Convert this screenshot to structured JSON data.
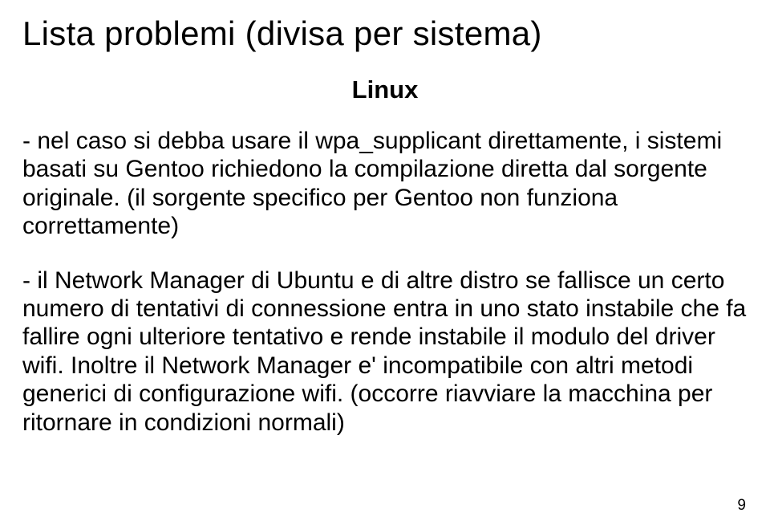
{
  "title": "Lista problemi (divisa per sistema)",
  "subtitle": "Linux",
  "para1": "- nel caso si debba usare il wpa_supplicant direttamente, i sistemi basati su Gentoo richiedono la compilazione diretta dal sorgente originale. (il sorgente specifico per Gentoo non funziona correttamente)",
  "para2": "- il Network Manager di Ubuntu e di altre distro se fallisce un certo numero di tentativi di connessione entra in uno stato instabile che fa fallire ogni ulteriore tentativo e rende instabile il modulo del driver wifi. Inoltre il Network Manager e' incompatibile con altri metodi generici di configurazione wifi. (occorre riavviare la macchina per ritornare in condizioni normali)",
  "pageNumber": "9"
}
